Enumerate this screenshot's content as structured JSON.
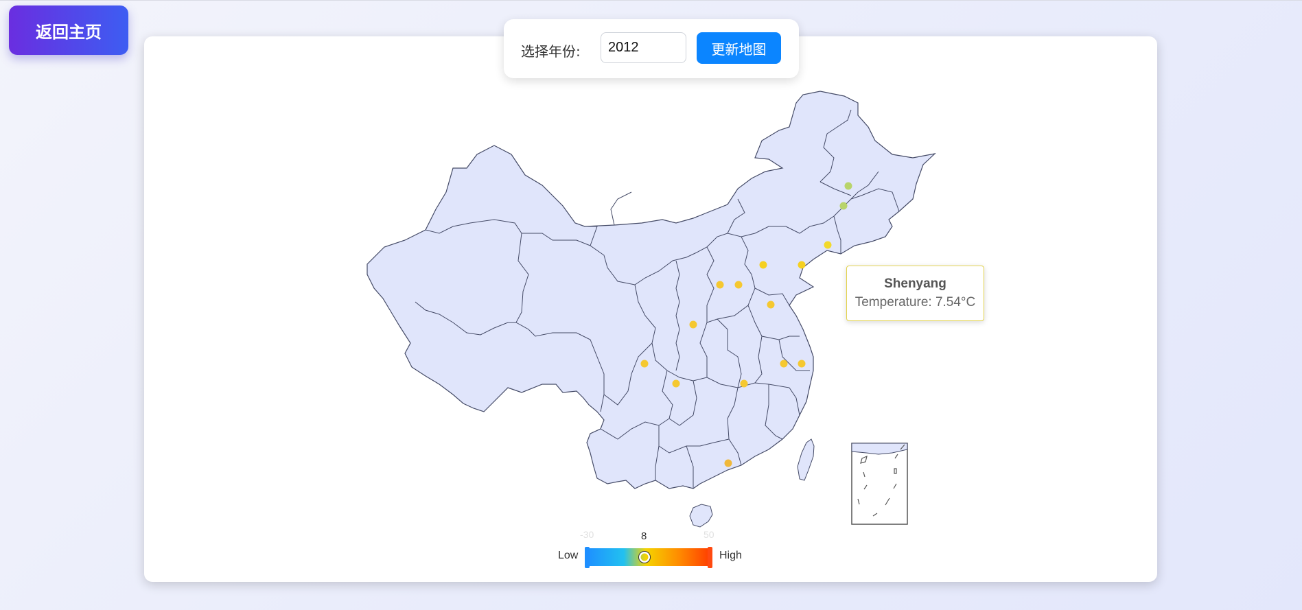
{
  "nav": {
    "back_label": "返回主页"
  },
  "controls": {
    "year_label": "选择年份:",
    "year_value": "2012",
    "update_label": "更新地图"
  },
  "tooltip": {
    "city": "Shenyang",
    "temperature_text": "Temperature: 7.54°C"
  },
  "visual_map": {
    "min_label": "-30",
    "max_label": "50",
    "current_value": "8",
    "low_text": "Low",
    "high_text": "High",
    "colors": [
      "#1e90ff",
      "#22c1f0",
      "#f5d300",
      "#ff8a00",
      "#ff3d00"
    ]
  },
  "map": {
    "region_fill": "#e0e5fb",
    "border_color": "#444a66",
    "points": [
      {
        "color": "#b8d46a"
      },
      {
        "color": "#b8d46a"
      },
      {
        "color": "#f2d92b"
      },
      {
        "color": "#f5d020"
      },
      {
        "color": "#f5d020"
      },
      {
        "color": "#f5c830"
      },
      {
        "color": "#f5c830"
      },
      {
        "color": "#f5c830"
      },
      {
        "color": "#f5c830"
      },
      {
        "color": "#f5c830"
      },
      {
        "color": "#f5c830"
      },
      {
        "color": "#f5c830"
      },
      {
        "color": "#f5c830"
      },
      {
        "color": "#f5c830"
      },
      {
        "color": "#f0b83a"
      }
    ]
  }
}
